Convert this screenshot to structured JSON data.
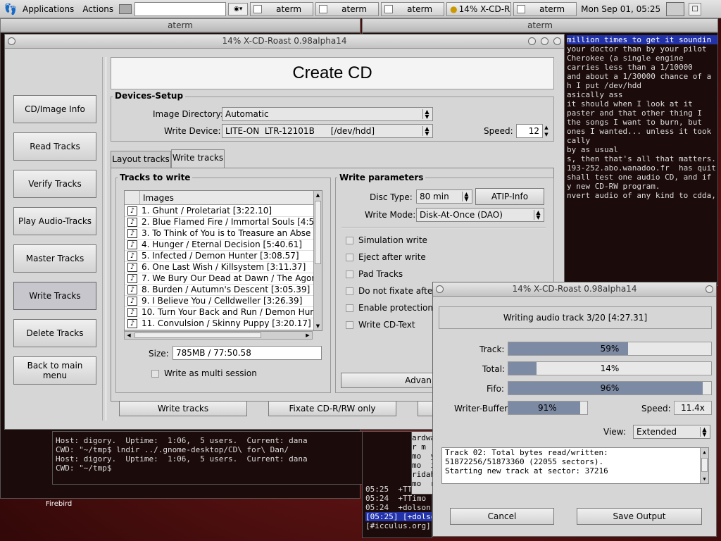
{
  "panel": {
    "applications": "Applications",
    "actions": "Actions",
    "tasks": [
      "aterm",
      "aterm",
      "aterm",
      "14% X-CD-R",
      "aterm"
    ],
    "clock": "Mon Sep 01, 05:25"
  },
  "term_left": {
    "title": "aterm",
    "lines": [
      "Host: digory.  Uptime:  1:06,  5 users.  Current: dana",
      "CWD: \"~/tmp$ lndir ../.gnome-desktop/CD\\ for\\ Dan/",
      "",
      "Host: digory.  Uptime:  1:06,  5 users.  Current: dana",
      "CWD: \"~/tmp$ "
    ]
  },
  "term_right": {
    "title": "aterm",
    "lines": [
      "million times to get it soundin",
      "your doctor than by your pilot",
      "",
      "Cherokee (a single engine",
      "carries less than a 1/10000",
      "and about a 1/30000 chance of a",
      "",
      "",
      "h I put /dev/hdd",
      "",
      "asically ass",
      "it should when I look at it",
      "paster and that other thing I",
      "",
      "the songs I want to burn, but",
      "ones I wanted... unless it took",
      "cally",
      "",
      "",
      "by as usual",
      "s, then that's all that matters.",
      "193-252.abo.wanadoo.fr  has quit",
      "",
      "shall test one audio CD, and if",
      "y new CD-RW program.",
      "nvert audio of any kind to cdda,"
    ]
  },
  "term_bottom": {
    "lines": [
      "05:25  +TTimo  e",
      "05:24  +TTimo  s",
      "05:24  +dolson",
      "[05:25] [+dolso",
      "[#icculus.org]"
    ],
    "side": [
      "ardwa",
      "r m",
      "mo  y",
      "mo  i",
      "ridah",
      "mo  r"
    ]
  },
  "desktop_label": "Firebird",
  "main": {
    "title": "14% X-CD-Roast 0.98alpha14",
    "heading": "Create CD",
    "sidebar": [
      "CD/Image Info",
      "Read Tracks",
      "Verify Tracks",
      "Play Audio-Tracks",
      "Master Tracks",
      "Write Tracks",
      "Delete Tracks",
      "Back to main menu"
    ],
    "devices": {
      "title": "Devices-Setup",
      "image_dir_label": "Image Directory:",
      "image_dir_value": "Automatic",
      "write_device_label": "Write Device:",
      "write_device_value": "LITE-ON  LTR-12101B      [/dev/hdd]",
      "speed_label": "Speed:",
      "speed_value": "12"
    },
    "tabs": [
      "Layout tracks",
      "Write tracks"
    ],
    "tracks": {
      "title": "Tracks to write",
      "header": "Images",
      "items": [
        "1. Ghunt / Proletariat [3:22.10]",
        "2. Blue Flamed Fire / Immortal Souls [4:54",
        "3. To Think of You is to Treasure an Abse",
        "4. Hunger / Eternal Decision [5:40.61]",
        "5. Infected / Demon Hunter [3:08.57]",
        "6. One Last Wish / Killsystem [3:11.37]",
        "7. We Bury Our Dead at Dawn / The Agor",
        "8. Burden / Autumn's Descent [3:05.39]",
        "9. I Believe You / Celldweller [3:26.39]",
        "10. Turn Your Back and Run / Demon Hun",
        "11. Convulsion / Skinny Puppy [3:20.17]"
      ],
      "size_label": "Size:",
      "size_value": "785MB / 77:50.58",
      "multi_session": "Write as multi session"
    },
    "params": {
      "title": "Write parameters",
      "disc_type_label": "Disc Type:",
      "disc_type_value": "80 min",
      "atip": "ATIP-Info",
      "write_mode_label": "Write Mode:",
      "write_mode_value": "Disk-At-Once (DAO)",
      "options": [
        "Simulation write",
        "Eject after write",
        "Pad Tracks",
        "Do not fixate after w",
        "Enable protection fi",
        "Write CD-Text"
      ],
      "advanced": "Advan"
    },
    "buttons": {
      "write": "Write tracks",
      "fixate": "Fixate CD-R/RW only"
    }
  },
  "progress_dialog": {
    "title": "14% X-CD-Roast 0.98alpha14",
    "status": "Writing audio track 3/20 [4:27.31]",
    "track_label": "Track:",
    "track_text": "59%",
    "track_pct": 59,
    "total_label": "Total:",
    "total_text": "14%",
    "total_pct": 14,
    "fifo_label": "Fifo:",
    "fifo_text": "96%",
    "fifo_pct": 96,
    "buffer_label": "Writer-Buffer:",
    "buffer_text": "91%",
    "buffer_pct": 91,
    "speed_label": "Speed:",
    "speed_value": "11.4x",
    "view_label": "View:",
    "view_value": "Extended",
    "log": [
      "Track 02: Total bytes read/written:",
      "51872256/51873360 (22055 sectors).",
      "Starting new track at sector: 37216"
    ],
    "cancel": "Cancel",
    "save": "Save Output"
  },
  "colors": {
    "progress_fill": "#7d8aa4",
    "selection": "#2233aa"
  }
}
